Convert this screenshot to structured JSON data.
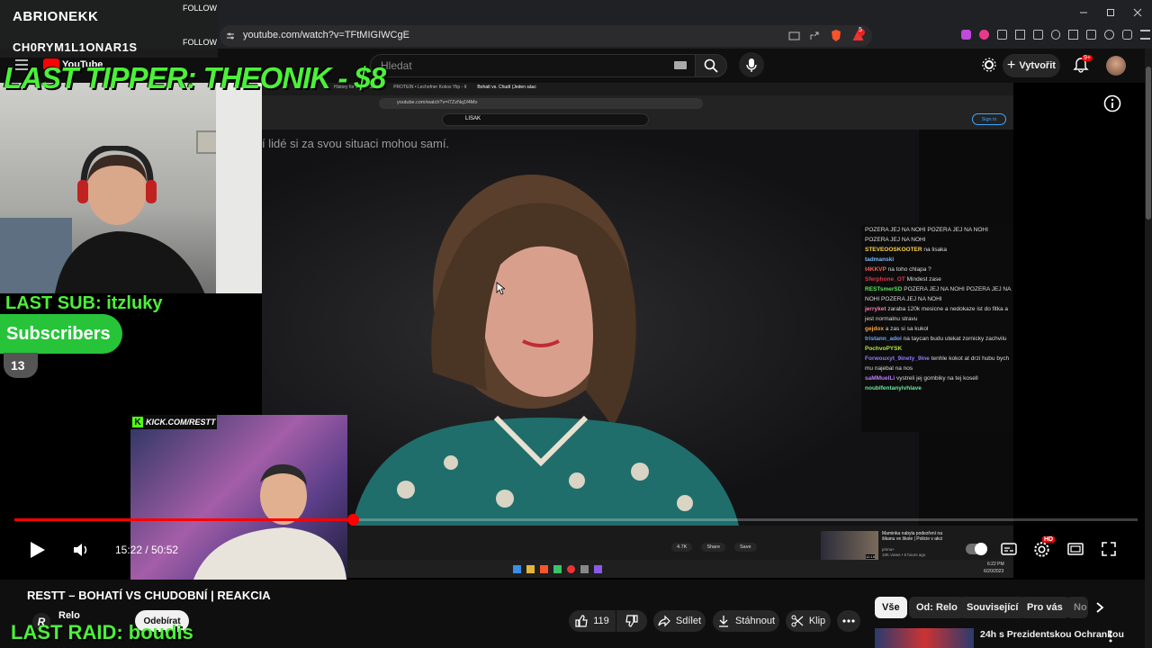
{
  "browser": {
    "url": "youtube.com/watch?v=TFtMIGIWCgE",
    "tab_count_badge": "5"
  },
  "youtube": {
    "logo_text": "YouTube",
    "search_placeholder": "Hledat",
    "create_label": "Vytvořit",
    "notif_badge": "9+"
  },
  "overlay": {
    "follower1_name": "ABRIONEKK",
    "follower1_action": "FOLLOW",
    "follower2_name": "CH0RYM1L1ONAR1S",
    "follower2_action": "FOLLOW",
    "last_tipper": "LAST TIPPER: THEONIK - $8",
    "last_sub": "LAST SUB: itzluky",
    "subscribers_label": "Subscribers",
    "subscribers_count": "13",
    "kick_url": "KICK.COM/RESTT",
    "last_raid": "LAST RAID: boudis"
  },
  "inner": {
    "url": "youtube.com/watch?v=I7ZzNq1f4Mo",
    "search": "LISAK",
    "signin": "Sign in",
    "tabs": [
      "History for Sleep Shares",
      "PROTEIN • Lechofner Kokos Ylip - It",
      "Bohatí vs. Chudí (Jeden sáuc"
    ],
    "subtitle": "í lidé si za svou situaci mohou samí.",
    "likes": "4.7K",
    "share": "Share",
    "save": "Save",
    "rec_title": "Maminka nabyla podezření na šikanu ve škole | Policie v akci",
    "rec_channel": "prima+",
    "rec_meta": "10K views • 6 hours ago",
    "rec_duration": "12:19",
    "clock": "6:22 PM",
    "date": "6/20/2023",
    "chat": [
      {
        "user": "",
        "msg": "POZERA JEJ NA NOHI POZERA JEJ NA NOHI POZERA JEJ NA NOHI"
      },
      {
        "user": "STEVEOOSKOOTER",
        "msg": "na lisaka"
      },
      {
        "user": "tadmanski",
        "msg": ""
      },
      {
        "user": "t4KKVP",
        "msg": "na toho chlapa ?"
      },
      {
        "user": "Sferphone_OT",
        "msg": "Mindest zase"
      },
      {
        "user": "RESTsmerSD",
        "msg": "POZERA JEJ NA NOHI POZERA JEJ NA NOHI POZERA JEJ NA NOHI"
      },
      {
        "user": "jerryket",
        "msg": "zaraba 120k mesicne a nedokaze ist do fitka a jest normalnu stravu"
      },
      {
        "user": "gejdox",
        "msg": "a zas si sa kukol"
      },
      {
        "user": "tristann_adoi",
        "msg": "na taycan budu utekat zornicky zachvilu"
      },
      {
        "user": "PochvoPYSK",
        "msg": ""
      },
      {
        "user": "Forwouxyt_9inety_9ine",
        "msg": "tenhle kokot at drzi hubu bych mu najebal na nos"
      },
      {
        "user": "saMMuelLi",
        "msg": "vystreli jej gombiky na tej kosell"
      },
      {
        "user": "noublfentanyivhlave",
        "msg": ""
      }
    ]
  },
  "player": {
    "current_time": "15:22",
    "duration": "50:52",
    "time_display": "15:22 / 50:52",
    "progress_fraction": 0.301,
    "hd_badge": "HD"
  },
  "video": {
    "title": "RESTT – BOHATÍ VS CHUDOBNÍ | REAKCIA",
    "channel": "Relo",
    "subscribe_label": "Odebírat",
    "likes": "119",
    "share_label": "Sdílet",
    "download_label": "Stáhnout",
    "clip_label": "Klip"
  },
  "chips": [
    "Vše",
    "Od: Relo",
    "Související",
    "Pro vás",
    "No"
  ],
  "next_video_title": "24h s Prezidentskou Ochrankou",
  "colors": {
    "accent_red": "#ff0000",
    "overlay_green": "#4cf03a",
    "sub_green": "#27c43a"
  }
}
